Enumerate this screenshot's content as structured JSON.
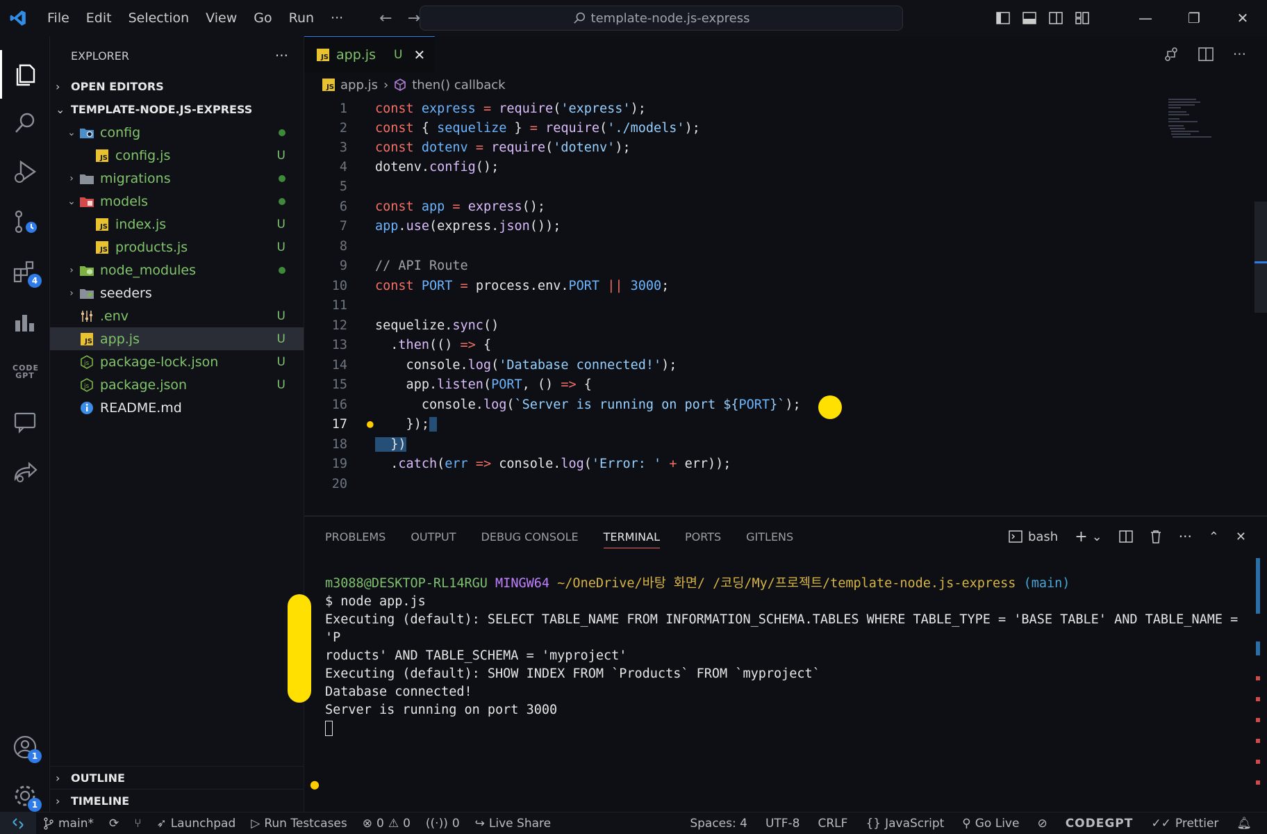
{
  "titlebar": {
    "menu": [
      "File",
      "Edit",
      "Selection",
      "View",
      "Go",
      "Run"
    ],
    "more": "···",
    "search": "template-node.js-express"
  },
  "activity": {
    "source_control_badge": "",
    "extensions_badge": "4",
    "accounts_badge": "1",
    "settings_badge": "1",
    "codegpt_label": "CODE GPT"
  },
  "explorer": {
    "title": "EXPLORER",
    "more": "···",
    "open_editors": "OPEN EDITORS",
    "project": "TEMPLATE-NODE.JS-EXPRESS",
    "items": [
      {
        "label": "config",
        "status": ""
      },
      {
        "label": "config.js",
        "status": "U"
      },
      {
        "label": "migrations",
        "status": ""
      },
      {
        "label": "models",
        "status": ""
      },
      {
        "label": "index.js",
        "status": "U"
      },
      {
        "label": "products.js",
        "status": "U"
      },
      {
        "label": "node_modules",
        "status": ""
      },
      {
        "label": "seeders",
        "status": ""
      },
      {
        "label": ".env",
        "status": "U"
      },
      {
        "label": "app.js",
        "status": "U"
      },
      {
        "label": "package-lock.json",
        "status": "U"
      },
      {
        "label": "package.json",
        "status": "U"
      },
      {
        "label": "README.md",
        "status": ""
      }
    ],
    "outline": "OUTLINE",
    "timeline": "TIMELINE"
  },
  "editor": {
    "tab_name": "app.js",
    "tab_status": "U",
    "breadcrumb_file": "app.js",
    "breadcrumb_symbol": "then() callback",
    "line_numbers": [
      "1",
      "2",
      "3",
      "4",
      "5",
      "6",
      "7",
      "8",
      "9",
      "10",
      "11",
      "12",
      "13",
      "14",
      "15",
      "16",
      "17",
      "18",
      "19",
      "20"
    ],
    "current_line": "17"
  },
  "panel": {
    "tabs": [
      "PROBLEMS",
      "OUTPUT",
      "DEBUG CONSOLE",
      "TERMINAL",
      "PORTS",
      "GITLENS"
    ],
    "shell": "bash"
  },
  "terminal": {
    "prompt_user": "m3088@DESKTOP-RL14RGU",
    "prompt_sys": "MINGW64",
    "prompt_path": "~/OneDrive/바탕 화면/  /코딩/My/프로젝트/template-node.js-express",
    "prompt_branch": "(main)",
    "command": "$ node app.js",
    "out1": "Executing (default): SELECT TABLE_NAME FROM INFORMATION_SCHEMA.TABLES WHERE TABLE_TYPE = 'BASE TABLE' AND TABLE_NAME = 'P",
    "out2": "roducts' AND TABLE_SCHEMA = 'myproject'",
    "out3": "Executing (default): SHOW INDEX FROM `Products` FROM `myproject`",
    "out4": "Database connected!",
    "out5": "Server is running on port 3000"
  },
  "statusbar": {
    "branch": "main*",
    "launchpad": "Launchpad",
    "testcases": "Run Testcases",
    "errors": "0",
    "warnings": "0",
    "ports": "0",
    "liveshare": "Live Share",
    "spaces": "Spaces: 4",
    "encoding": "UTF-8",
    "eol": "CRLF",
    "language": "JavaScript",
    "golive": "Go Live",
    "codegpt": "CODEGPT",
    "prettier": "Prettier"
  },
  "colors": {
    "accent": "#2f7be8",
    "git_untracked": "#81c46b",
    "highlight": "#ffe000"
  }
}
